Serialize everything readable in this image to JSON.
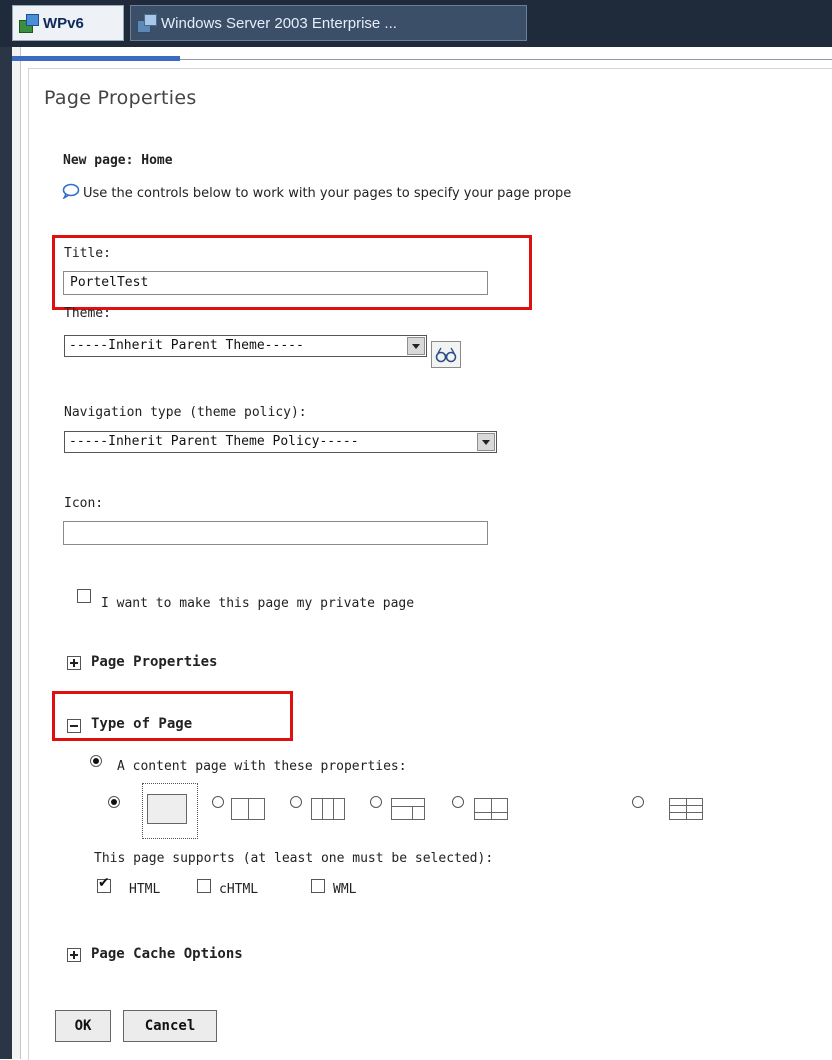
{
  "tabs": [
    {
      "label": "WPv6"
    },
    {
      "label": "Windows Server 2003 Enterprise ..."
    }
  ],
  "heading": "Page Properties",
  "new_page": "New page: Home",
  "info_text": "Use the controls below to work with your pages to specify your page prope",
  "title_field": {
    "label": "Title:",
    "value": "PortelTest"
  },
  "theme": {
    "label": "Theme:",
    "selected": "-----Inherit Parent Theme-----"
  },
  "navigation": {
    "label": "Navigation type (theme policy):",
    "selected": "-----Inherit Parent Theme Policy-----"
  },
  "icon_field": {
    "label": "Icon:",
    "value": ""
  },
  "private_checkbox": {
    "label": "I want to make this page my private page",
    "checked": false
  },
  "sections": {
    "page_properties": "Page Properties",
    "type_of_page": "Type of Page",
    "cache_options": "Page Cache Options"
  },
  "content_page_option": "A content page with these properties:",
  "supports_text": "This page supports (at least one must be selected):",
  "markups": [
    {
      "label": "HTML",
      "checked": true
    },
    {
      "label": "cHTML",
      "checked": false
    },
    {
      "label": "WML",
      "checked": false
    }
  ],
  "buttons": {
    "ok": "OK",
    "cancel": "Cancel"
  },
  "colors": {
    "highlight": "#e01010",
    "tab_bar": "#1f2b3a",
    "accent": "#3b6bbf"
  }
}
